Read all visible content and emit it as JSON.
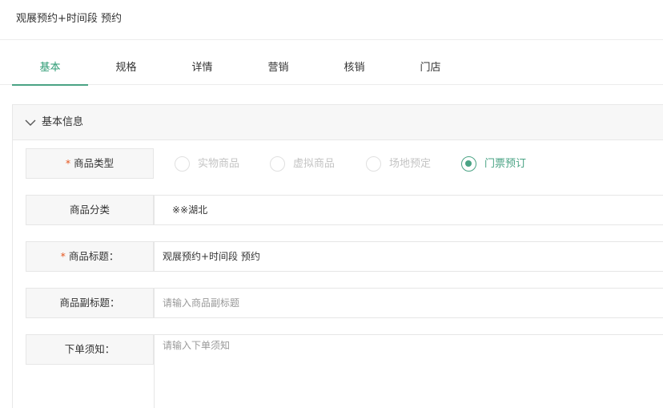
{
  "header": {
    "title": "观展预约+时间段 预约"
  },
  "tabs": [
    {
      "label": "基本",
      "active": true
    },
    {
      "label": "规格",
      "active": false
    },
    {
      "label": "详情",
      "active": false
    },
    {
      "label": "营销",
      "active": false
    },
    {
      "label": "核销",
      "active": false
    },
    {
      "label": "门店",
      "active": false
    }
  ],
  "panel": {
    "title": "基本信息"
  },
  "form": {
    "product_type": {
      "label": "商品类型",
      "required_mark": "*",
      "options": [
        {
          "label": "实物商品",
          "checked": false
        },
        {
          "label": "虚拟商品",
          "checked": false
        },
        {
          "label": "场地预定",
          "checked": false
        },
        {
          "label": "门票预订",
          "checked": true
        }
      ]
    },
    "category": {
      "label": "商品分类",
      "value": "※※湖北"
    },
    "title": {
      "label": "商品标题：",
      "required_mark": "*",
      "value": "观展预约+时间段 预约"
    },
    "subtitle": {
      "label": "商品副标题：",
      "placeholder": "请输入商品副标题"
    },
    "notice": {
      "label": "下单须知：",
      "placeholder": "请输入下单须知"
    }
  },
  "colors": {
    "accent": "#4aa384",
    "required": "#e6561f"
  }
}
